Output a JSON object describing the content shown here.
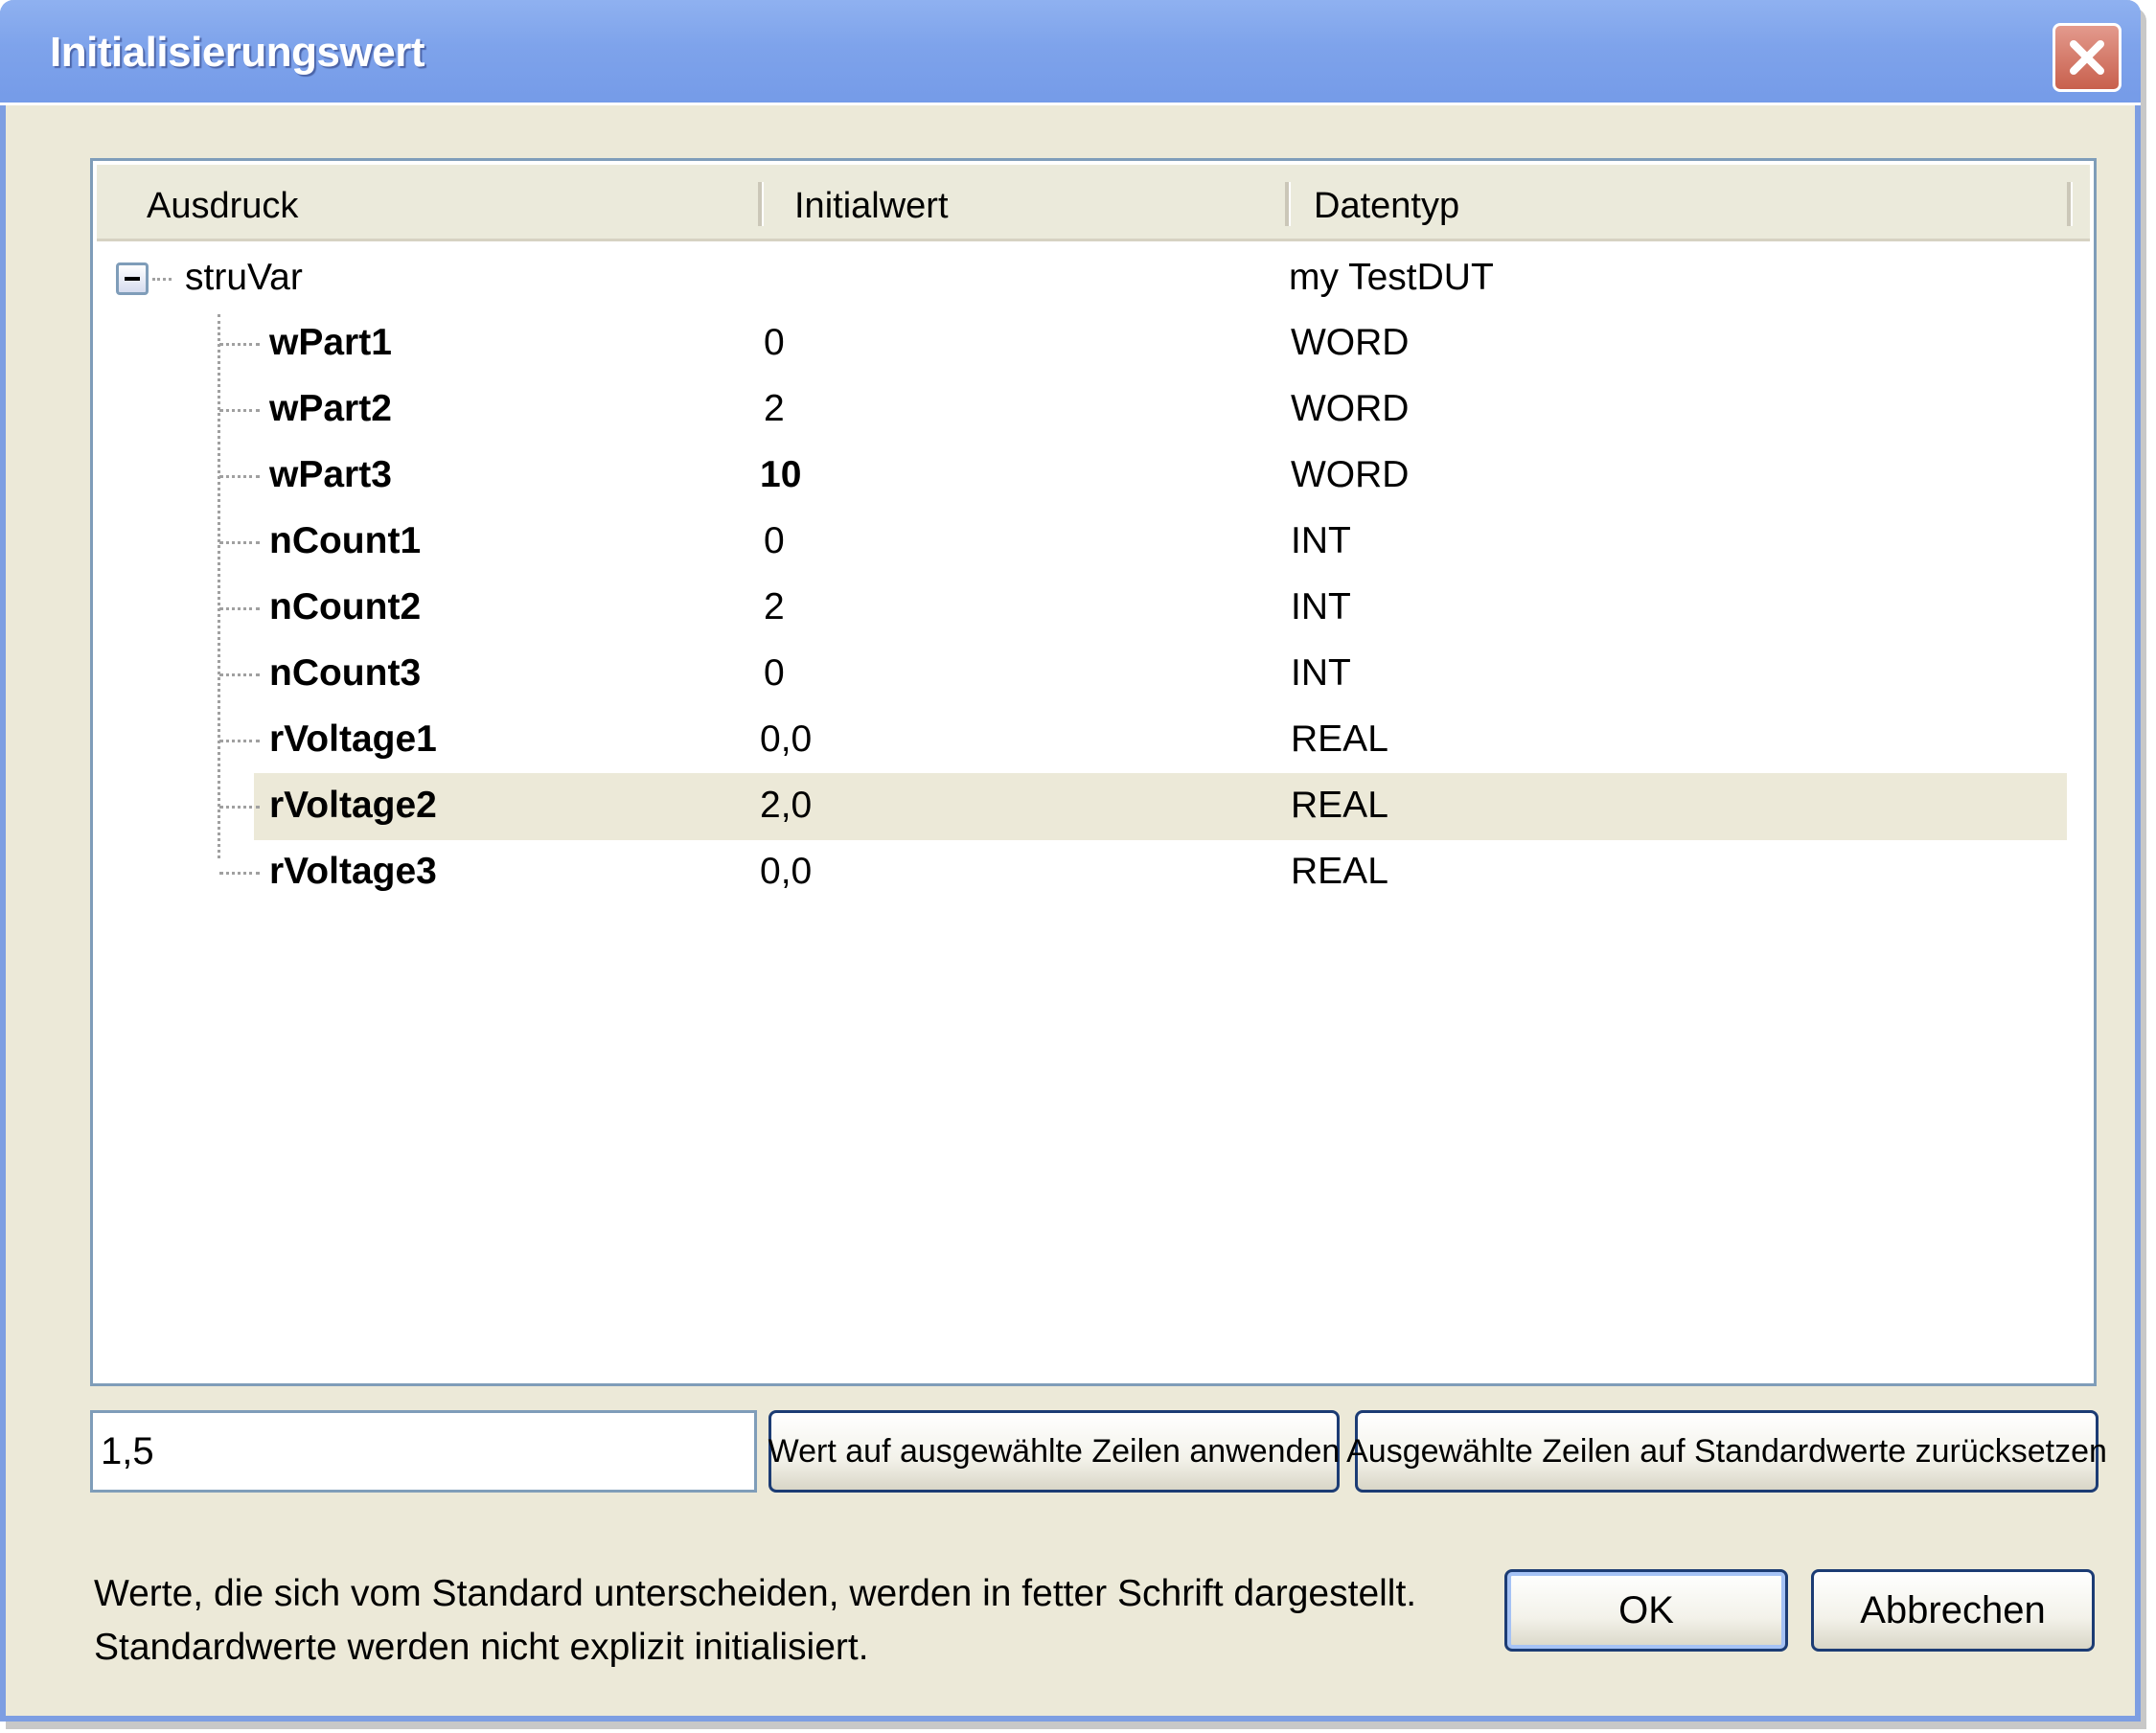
{
  "window": {
    "title": "Initialisierungswert"
  },
  "table": {
    "columns": [
      "Ausdruck",
      "Initialwert",
      "Datentyp"
    ],
    "root": {
      "expression": "struVar",
      "datatype": "my TestDUT"
    },
    "rows": [
      {
        "expression": "wPart1",
        "value": "0",
        "datatype": "WORD",
        "value_bold": false
      },
      {
        "expression": "wPart2",
        "value": "2",
        "datatype": "WORD",
        "value_bold": false
      },
      {
        "expression": "wPart3",
        "value": "10",
        "datatype": "WORD",
        "value_bold": true
      },
      {
        "expression": "nCount1",
        "value": "0",
        "datatype": "INT",
        "value_bold": false
      },
      {
        "expression": "nCount2",
        "value": "2",
        "datatype": "INT",
        "value_bold": false
      },
      {
        "expression": "nCount3",
        "value": "0",
        "datatype": "INT",
        "value_bold": false
      },
      {
        "expression": "rVoltage1",
        "value": "0,0",
        "datatype": "REAL",
        "value_bold": false
      },
      {
        "expression": "rVoltage2",
        "value": "2,0",
        "datatype": "REAL",
        "value_bold": false
      },
      {
        "expression": "rVoltage3",
        "value": "0,0",
        "datatype": "REAL",
        "value_bold": false
      }
    ],
    "selected_row": "rVoltage2"
  },
  "controls": {
    "value_input": "1,5",
    "apply_button": "Wert auf ausgewählte Zeilen anwenden",
    "reset_button": "Ausgewählte Zeilen auf Standardwerte zurücksetzen",
    "ok_button": "OK",
    "cancel_button": "Abbrechen"
  },
  "info": {
    "line1": "Werte, die sich vom Standard unterscheiden, werden in fetter Schrift dargestellt.",
    "line2": "Standardwerte werden nicht explizit initialisiert."
  },
  "icons": [
    "close-icon",
    "collapse-icon"
  ]
}
